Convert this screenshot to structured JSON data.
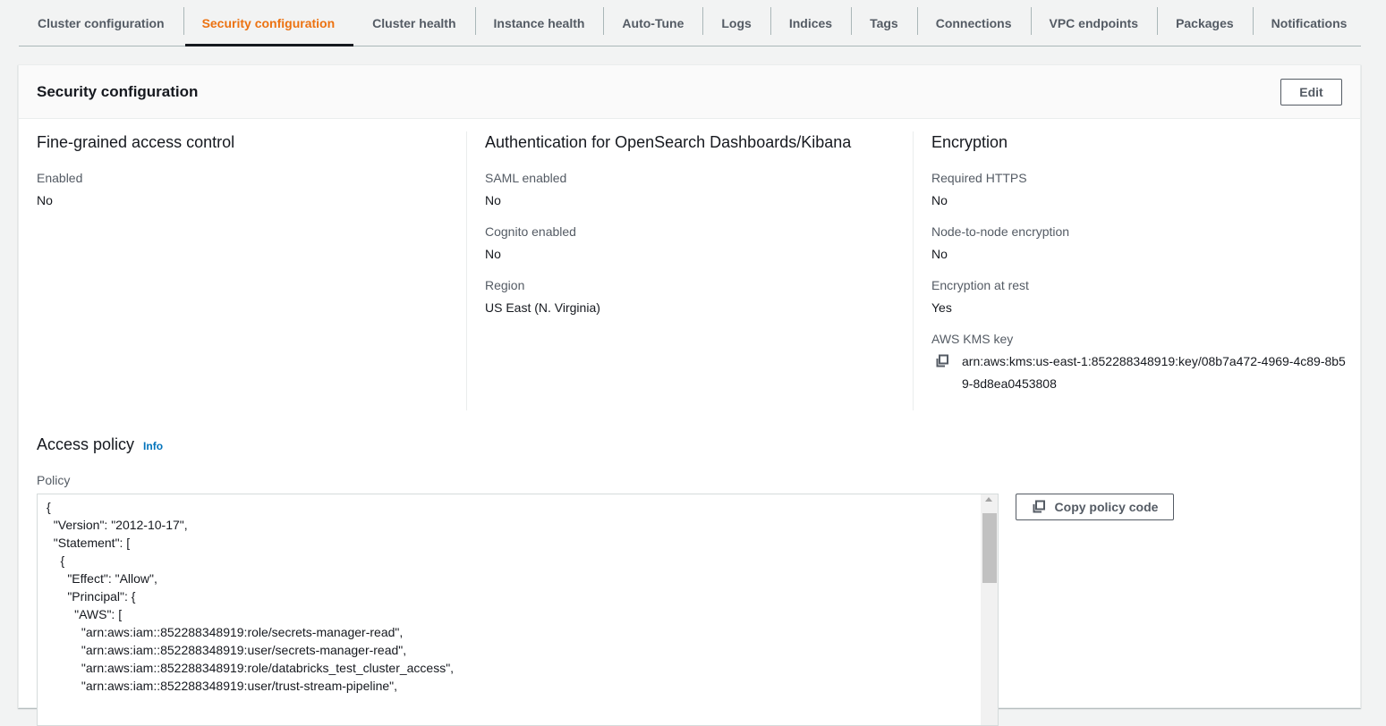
{
  "tabs": [
    {
      "label": "Cluster configuration",
      "active": false
    },
    {
      "label": "Security configuration",
      "active": true
    },
    {
      "label": "Cluster health",
      "active": false
    },
    {
      "label": "Instance health",
      "active": false
    },
    {
      "label": "Auto-Tune",
      "active": false
    },
    {
      "label": "Logs",
      "active": false
    },
    {
      "label": "Indices",
      "active": false
    },
    {
      "label": "Tags",
      "active": false
    },
    {
      "label": "Connections",
      "active": false
    },
    {
      "label": "VPC endpoints",
      "active": false
    },
    {
      "label": "Packages",
      "active": false
    },
    {
      "label": "Notifications",
      "active": false
    }
  ],
  "panel": {
    "title": "Security configuration",
    "edit_label": "Edit"
  },
  "fgac": {
    "title": "Fine-grained access control",
    "enabled_label": "Enabled",
    "enabled_value": "No"
  },
  "auth": {
    "title": "Authentication for OpenSearch Dashboards/Kibana",
    "saml_label": "SAML enabled",
    "saml_value": "No",
    "cognito_label": "Cognito enabled",
    "cognito_value": "No",
    "region_label": "Region",
    "region_value": "US East (N. Virginia)"
  },
  "encryption": {
    "title": "Encryption",
    "https_label": "Required HTTPS",
    "https_value": "No",
    "n2n_label": "Node-to-node encryption",
    "n2n_value": "No",
    "rest_label": "Encryption at rest",
    "rest_value": "Yes",
    "kms_label": "AWS KMS key",
    "kms_value": "arn:aws:kms:us-east-1:852288348919:key/08b7a472-4969-4c89-8b59-8d8ea0453808",
    "kms_icon": "copy-icon"
  },
  "access": {
    "title": "Access policy",
    "info_label": "Info",
    "policy_label": "Policy",
    "copy_label": "Copy policy code",
    "copy_icon": "copy-icon",
    "code_lines": [
      "{",
      "  \"Version\": \"2012-10-17\",",
      "  \"Statement\": [",
      "    {",
      "      \"Effect\": \"Allow\",",
      "      \"Principal\": {",
      "        \"AWS\": [",
      "          \"arn:aws:iam::852288348919:role/secrets-manager-read\",",
      "          \"arn:aws:iam::852288348919:user/secrets-manager-read\",",
      "          \"arn:aws:iam::852288348919:role/databricks_test_cluster_access\",",
      "          \"arn:aws:iam::852288348919:user/trust-stream-pipeline\","
    ]
  },
  "colors": {
    "accent": "#ec7211",
    "link": "#0073bb"
  }
}
